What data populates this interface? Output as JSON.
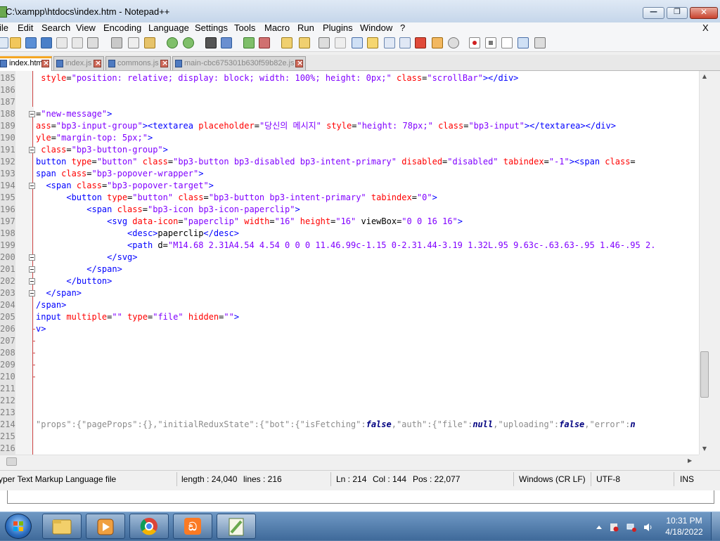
{
  "window": {
    "title": "C:\\xampp\\htdocs\\index.htm - Notepad++"
  },
  "menu": {
    "items": [
      "ile",
      "Edit",
      "Search",
      "View",
      "Encoding",
      "Language",
      "Settings",
      "Tools",
      "Macro",
      "Run",
      "Plugins",
      "Window",
      "?"
    ],
    "close_label": "X"
  },
  "tabs": [
    {
      "label": "index.htm",
      "active": true
    },
    {
      "label": "index.js",
      "active": false
    },
    {
      "label": "commons.js",
      "active": false
    },
    {
      "label": "main-cbc675301b630f59b82e.js",
      "active": false
    }
  ],
  "editor": {
    "lines": [
      {
        "num": "185",
        "segs": [
          {
            "c": "attr",
            "t": " style"
          },
          {
            "c": "txt",
            "t": "="
          },
          {
            "c": "val",
            "t": "\"position: relative; display: block; width: 100%; height: 0px;\""
          },
          {
            "c": "txt",
            "t": " "
          },
          {
            "c": "attr",
            "t": "class"
          },
          {
            "c": "txt",
            "t": "="
          },
          {
            "c": "val",
            "t": "\"scrollBar\""
          },
          {
            "c": "tag",
            "t": "></div>"
          }
        ]
      },
      {
        "num": "186",
        "segs": []
      },
      {
        "num": "187",
        "segs": []
      },
      {
        "num": "188",
        "segs": [
          {
            "c": "txt",
            "t": "="
          },
          {
            "c": "val",
            "t": "\"new-message\""
          },
          {
            "c": "tag",
            "t": ">"
          }
        ]
      },
      {
        "num": "189",
        "segs": [
          {
            "c": "attr",
            "t": "ass"
          },
          {
            "c": "txt",
            "t": "="
          },
          {
            "c": "val",
            "t": "\"bp3-input-group\""
          },
          {
            "c": "tag",
            "t": "><textarea"
          },
          {
            "c": "txt",
            "t": " "
          },
          {
            "c": "attr",
            "t": "placeholder"
          },
          {
            "c": "txt",
            "t": "="
          },
          {
            "c": "val",
            "t": "\"당신의 메시지\""
          },
          {
            "c": "txt",
            "t": " "
          },
          {
            "c": "attr",
            "t": "style"
          },
          {
            "c": "txt",
            "t": "="
          },
          {
            "c": "val",
            "t": "\"height: 78px;\""
          },
          {
            "c": "txt",
            "t": " "
          },
          {
            "c": "attr",
            "t": "class"
          },
          {
            "c": "txt",
            "t": "="
          },
          {
            "c": "val",
            "t": "\"bp3-input\""
          },
          {
            "c": "tag",
            "t": "></textarea></div>"
          }
        ]
      },
      {
        "num": "190",
        "segs": [
          {
            "c": "attr",
            "t": "yle"
          },
          {
            "c": "txt",
            "t": "="
          },
          {
            "c": "val",
            "t": "\"margin-top: 5px;\""
          },
          {
            "c": "tag",
            "t": ">"
          }
        ]
      },
      {
        "num": "191",
        "segs": [
          {
            "c": "attr",
            "t": " class"
          },
          {
            "c": "txt",
            "t": "="
          },
          {
            "c": "val",
            "t": "\"bp3-button-group\""
          },
          {
            "c": "tag",
            "t": ">"
          }
        ]
      },
      {
        "num": "192",
        "segs": [
          {
            "c": "tag",
            "t": "button"
          },
          {
            "c": "txt",
            "t": " "
          },
          {
            "c": "attr",
            "t": "type"
          },
          {
            "c": "txt",
            "t": "="
          },
          {
            "c": "val",
            "t": "\"button\""
          },
          {
            "c": "txt",
            "t": " "
          },
          {
            "c": "attr",
            "t": "class"
          },
          {
            "c": "txt",
            "t": "="
          },
          {
            "c": "val",
            "t": "\"bp3-button bp3-disabled bp3-intent-primary\""
          },
          {
            "c": "txt",
            "t": " "
          },
          {
            "c": "attr",
            "t": "disabled"
          },
          {
            "c": "txt",
            "t": "="
          },
          {
            "c": "val",
            "t": "\"disabled\""
          },
          {
            "c": "txt",
            "t": " "
          },
          {
            "c": "attr",
            "t": "tabindex"
          },
          {
            "c": "txt",
            "t": "="
          },
          {
            "c": "val",
            "t": "\"-1\""
          },
          {
            "c": "tag",
            "t": "><span"
          },
          {
            "c": "txt",
            "t": " "
          },
          {
            "c": "attr",
            "t": "class"
          },
          {
            "c": "txt",
            "t": "="
          }
        ]
      },
      {
        "num": "193",
        "segs": [
          {
            "c": "tag",
            "t": "span"
          },
          {
            "c": "txt",
            "t": " "
          },
          {
            "c": "attr",
            "t": "class"
          },
          {
            "c": "txt",
            "t": "="
          },
          {
            "c": "val",
            "t": "\"bp3-popover-wrapper\""
          },
          {
            "c": "tag",
            "t": ">"
          }
        ]
      },
      {
        "num": "194",
        "segs": [
          {
            "c": "tag",
            "t": "  <span"
          },
          {
            "c": "txt",
            "t": " "
          },
          {
            "c": "attr",
            "t": "class"
          },
          {
            "c": "txt",
            "t": "="
          },
          {
            "c": "val",
            "t": "\"bp3-popover-target\""
          },
          {
            "c": "tag",
            "t": ">"
          }
        ]
      },
      {
        "num": "195",
        "segs": [
          {
            "c": "tag",
            "t": "      <button"
          },
          {
            "c": "txt",
            "t": " "
          },
          {
            "c": "attr",
            "t": "type"
          },
          {
            "c": "txt",
            "t": "="
          },
          {
            "c": "val",
            "t": "\"button\""
          },
          {
            "c": "txt",
            "t": " "
          },
          {
            "c": "attr",
            "t": "class"
          },
          {
            "c": "txt",
            "t": "="
          },
          {
            "c": "val",
            "t": "\"bp3-button bp3-intent-primary\""
          },
          {
            "c": "txt",
            "t": " "
          },
          {
            "c": "attr",
            "t": "tabindex"
          },
          {
            "c": "txt",
            "t": "="
          },
          {
            "c": "val",
            "t": "\"0\""
          },
          {
            "c": "tag",
            "t": ">"
          }
        ]
      },
      {
        "num": "196",
        "segs": [
          {
            "c": "tag",
            "t": "          <span"
          },
          {
            "c": "txt",
            "t": " "
          },
          {
            "c": "attr",
            "t": "class"
          },
          {
            "c": "txt",
            "t": "="
          },
          {
            "c": "val",
            "t": "\"bp3-icon bp3-icon-paperclip\""
          },
          {
            "c": "tag",
            "t": ">"
          }
        ]
      },
      {
        "num": "197",
        "segs": [
          {
            "c": "tag",
            "t": "              <svg"
          },
          {
            "c": "txt",
            "t": " "
          },
          {
            "c": "attr",
            "t": "data-icon"
          },
          {
            "c": "txt",
            "t": "="
          },
          {
            "c": "val",
            "t": "\"paperclip\""
          },
          {
            "c": "txt",
            "t": " "
          },
          {
            "c": "attr",
            "t": "width"
          },
          {
            "c": "txt",
            "t": "="
          },
          {
            "c": "val",
            "t": "\"16\""
          },
          {
            "c": "txt",
            "t": " "
          },
          {
            "c": "attr",
            "t": "height"
          },
          {
            "c": "txt",
            "t": "="
          },
          {
            "c": "val",
            "t": "\"16\""
          },
          {
            "c": "txt",
            "t": " viewBox="
          },
          {
            "c": "val",
            "t": "\"0 0 16 16\""
          },
          {
            "c": "tag",
            "t": ">"
          }
        ]
      },
      {
        "num": "198",
        "segs": [
          {
            "c": "tag",
            "t": "                  <desc>"
          },
          {
            "c": "txt",
            "t": "paperclip"
          },
          {
            "c": "tag",
            "t": "</desc>"
          }
        ]
      },
      {
        "num": "199",
        "segs": [
          {
            "c": "tag",
            "t": "                  <path"
          },
          {
            "c": "txt",
            "t": " d="
          },
          {
            "c": "val",
            "t": "\"M14.68 2.31A4.54 4.54 0 0 0 11.46.99c-1.15 0-2.31.44-3.19 1.32L.95 9.63c-.63.63-.95 1.46-.95 2."
          }
        ]
      },
      {
        "num": "200",
        "segs": [
          {
            "c": "tag",
            "t": "              </svg>"
          }
        ]
      },
      {
        "num": "201",
        "segs": [
          {
            "c": "tag",
            "t": "          </span>"
          }
        ]
      },
      {
        "num": "202",
        "segs": [
          {
            "c": "tag",
            "t": "      </button>"
          }
        ]
      },
      {
        "num": "203",
        "segs": [
          {
            "c": "tag",
            "t": "  </span>"
          }
        ]
      },
      {
        "num": "204",
        "segs": [
          {
            "c": "tag",
            "t": "/span>"
          }
        ]
      },
      {
        "num": "205",
        "segs": [
          {
            "c": "tag",
            "t": "input"
          },
          {
            "c": "txt",
            "t": " "
          },
          {
            "c": "attr",
            "t": "multiple"
          },
          {
            "c": "txt",
            "t": "="
          },
          {
            "c": "val",
            "t": "\"\""
          },
          {
            "c": "txt",
            "t": " "
          },
          {
            "c": "attr",
            "t": "type"
          },
          {
            "c": "txt",
            "t": "="
          },
          {
            "c": "val",
            "t": "\"file\""
          },
          {
            "c": "txt",
            "t": " "
          },
          {
            "c": "attr",
            "t": "hidden"
          },
          {
            "c": "txt",
            "t": "="
          },
          {
            "c": "val",
            "t": "\"\""
          },
          {
            "c": "tag",
            "t": ">"
          }
        ]
      },
      {
        "num": "206",
        "segs": [
          {
            "c": "tag",
            "t": "v>"
          }
        ]
      },
      {
        "num": "207",
        "segs": []
      },
      {
        "num": "208",
        "segs": []
      },
      {
        "num": "209",
        "segs": []
      },
      {
        "num": "210",
        "segs": []
      },
      {
        "num": "211",
        "segs": []
      },
      {
        "num": "212",
        "segs": []
      },
      {
        "num": "213",
        "segs": []
      },
      {
        "num": "214",
        "segs": [
          {
            "c": "js",
            "t": "\"props\":{\"pageProps\":{},\"initialReduxState\":{\"bot\":{\"isFetching\":"
          },
          {
            "c": "b",
            "t": "false"
          },
          {
            "c": "js",
            "t": ",\"auth\":{\"file\":"
          },
          {
            "c": "b",
            "t": "null"
          },
          {
            "c": "js",
            "t": ",\"uploading\":"
          },
          {
            "c": "b",
            "t": "false"
          },
          {
            "c": "js",
            "t": ",\"error\":"
          },
          {
            "c": "b",
            "t": "n"
          }
        ]
      },
      {
        "num": "215",
        "segs": []
      },
      {
        "num": "216",
        "segs": []
      }
    ]
  },
  "status": {
    "file_type": "yper Text Markup Language file",
    "length": "length : 24,040",
    "lines": "lines : 216",
    "ln": "Ln : 214",
    "col": "Col : 144",
    "pos": "Pos : 22,077",
    "eol": "Windows (CR LF)",
    "encoding": "UTF-8",
    "mode": "INS"
  },
  "taskbar": {
    "time": "10:31 PM",
    "date": "4/18/2022",
    "apps": [
      "windows-explorer",
      "media-player",
      "chrome",
      "xampp",
      "notepad-plus-plus"
    ]
  },
  "colors": {
    "tag": "#0000ff",
    "attr": "#ff0000",
    "value": "#8000ff",
    "active_tab_accent": "#f5a623"
  }
}
